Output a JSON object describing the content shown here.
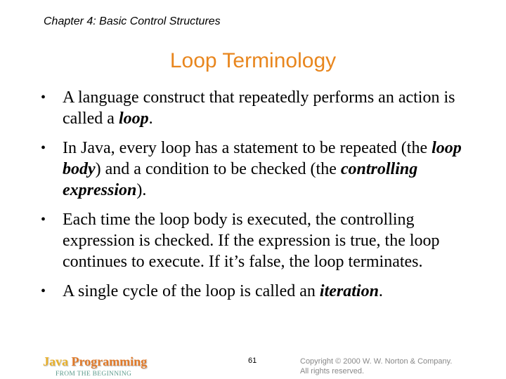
{
  "header": {
    "chapter": "Chapter 4: Basic Control Structures",
    "title": "Loop Terminology"
  },
  "bullets": [
    {
      "parts": [
        {
          "text": "A language construct that repeatedly performs an action is called a ",
          "emphasis": false
        },
        {
          "text": "loop",
          "emphasis": true
        },
        {
          "text": ".",
          "emphasis": false
        }
      ]
    },
    {
      "parts": [
        {
          "text": "In Java, every loop has a statement to be repeated (the ",
          "emphasis": false
        },
        {
          "text": "loop body",
          "emphasis": true
        },
        {
          "text": ") and a condition to be checked (the ",
          "emphasis": false
        },
        {
          "text": "controlling expression",
          "emphasis": true
        },
        {
          "text": ").",
          "emphasis": false
        }
      ]
    },
    {
      "parts": [
        {
          "text": "Each time the loop body is executed, the controlling expression is checked. If the expression is true, the loop continues to execute. If it’s false, the loop terminates.",
          "emphasis": false
        }
      ]
    },
    {
      "parts": [
        {
          "text": "A single cycle of the loop is called an ",
          "emphasis": false
        },
        {
          "text": "iteration",
          "emphasis": true
        },
        {
          "text": ".",
          "emphasis": false
        }
      ]
    }
  ],
  "bullet_glyph": "•",
  "footer": {
    "logo_word1": "Java",
    "logo_word2": "Programming",
    "logo_subtitle": "FROM THE BEGINNING",
    "page_number": "61",
    "copyright_line1": "Copyright © 2000 W. W. Norton & Company.",
    "copyright_line2": "All rights reserved."
  },
  "colors": {
    "title": "#e8861e",
    "logo_java": "#e8b02c",
    "logo_programming": "#e07a2a",
    "logo_subtitle": "#5c9a8c",
    "copyright": "#888888"
  }
}
